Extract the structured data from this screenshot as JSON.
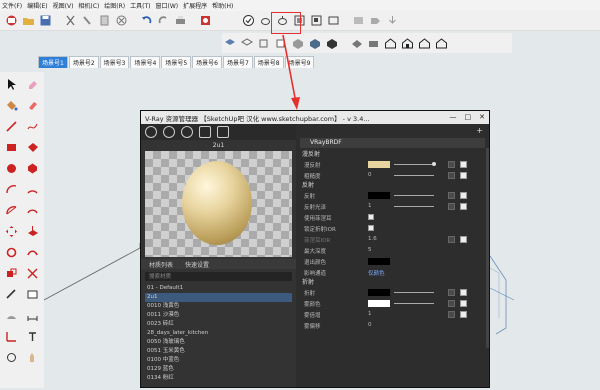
{
  "menu": [
    "文件(F)",
    "编辑(E)",
    "视图(V)",
    "相机(C)",
    "绘图(R)",
    "工具(T)",
    "窗口(W)",
    "扩展程序",
    "帮助(H)"
  ],
  "scenes": [
    "场景号1",
    "场景号2",
    "场景号3",
    "场景号4",
    "场景号5",
    "场景号6",
    "场景号7",
    "场景号8",
    "场景号9"
  ],
  "vray": {
    "title": "V-Ray 资源管理器 【SketchUp吧 汉化 www.sketchupbar.com】 - v 3.4...",
    "window_min": "—",
    "window_max": "□",
    "window_close": "✕",
    "preview_label": "2u1",
    "subtab_list": "材质列表",
    "subtab_quick": "快速设置",
    "search_placeholder": "搜索材质",
    "materials": [
      "01 - Default1",
      "2u1",
      "0010 浅黄色",
      "0011 沙漠色",
      "0023 砖红",
      "28_days_later_kitchen",
      "0050 浅玻璃色",
      "0051 玉米黄色",
      "0100 中蓝色",
      "0129 蓝色",
      "0134 粉红"
    ],
    "add_symbol": "+",
    "brdf_label": "VRayBRDF",
    "sections": {
      "diffuse": "漫反射",
      "reflection": "反射",
      "refraction": "折射"
    },
    "params": {
      "diffuse": "漫反射",
      "roughness": "粗糙度",
      "roughness_value": "0",
      "reflection": "反射",
      "refl_gloss": "反射光泽",
      "refl_gloss_value": "1",
      "use_gloss": "使用菲涅耳",
      "lock_ior": "锁定折射IOR",
      "fresnel_ior": "菲涅耳IOR",
      "fresnel_ior_value": "1.6",
      "max_depth": "最大深度",
      "max_depth_value": "5",
      "exit_color": "退出颜色",
      "affect_channels": "影响通道",
      "affect_value": "仅颜色",
      "refraction": "折射",
      "fog_color": "雾颜色",
      "fog_mult": "雾倍增",
      "fog_mult_value": "1",
      "fog_bias": "雾偏移",
      "fog_bias_value": "0"
    }
  }
}
